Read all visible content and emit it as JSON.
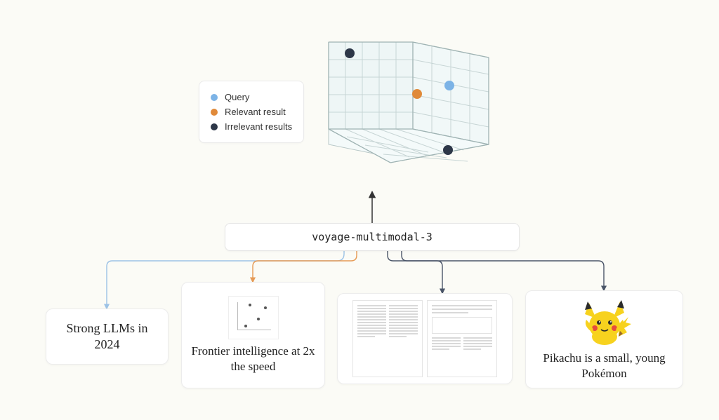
{
  "legend": {
    "query": "Query",
    "relevant": "Relevant result",
    "irrelevant": "Irrelevant results"
  },
  "model": {
    "name": "voyage-multimodal-3"
  },
  "inputs": {
    "card1": {
      "text": "Strong LLMs in 2024"
    },
    "card2": {
      "text": "Frontier intelligence at 2x the speed"
    },
    "card3": {
      "text": ""
    },
    "card4": {
      "text": "Pikachu is a small, young Pokémon"
    }
  },
  "colors": {
    "query": "#7cb3e6",
    "relevant": "#e08a3a",
    "irrelevant": "#2d3748",
    "query_line": "#9cc2e6",
    "relevant_line": "#e69a55",
    "irrelevant_line": "#4a5568"
  },
  "embedding_points": [
    {
      "label": "irrelevant-top-left",
      "type": "irrelevant"
    },
    {
      "label": "relevant-center",
      "type": "relevant"
    },
    {
      "label": "query-right",
      "type": "query"
    },
    {
      "label": "irrelevant-bottom",
      "type": "irrelevant"
    }
  ]
}
